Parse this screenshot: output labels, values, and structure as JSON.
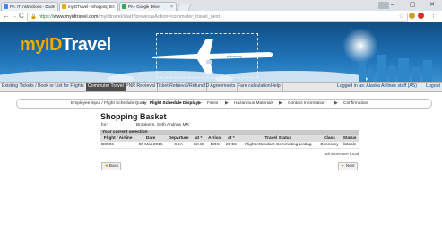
{
  "browser": {
    "tabs": [
      {
        "label": "PA: IT Instructions - Docs"
      },
      {
        "label": "myIDTravel - Shopping B..."
      },
      {
        "label": "PA - Google Drive"
      }
    ],
    "window_controls": {
      "minimize": "–",
      "maximize": "▢",
      "close": "✕"
    },
    "url": {
      "scheme": "https://",
      "host": "www.myidtravel.com",
      "path": "/myidtravel/start?previousAction=commuter_travel_next"
    }
  },
  "banner": {
    "logo_part1": "myID",
    "logo_part2": "Travel",
    "plane_text": "planeway"
  },
  "mainnav": {
    "items": [
      "Existing Tickets / Book or List for Flights",
      "Commuter Travel",
      "PNR Retrieval",
      "Ticket Retrieval/Refund",
      "ID Agreements",
      "Fare calculation",
      "Help"
    ],
    "logged_in": "Logged in as: Alaska Airlines staff (AS)",
    "logout": "Logout"
  },
  "steps": [
    "Employee input / Flight Schedule Query",
    "Flight Schedule Display",
    "Fares",
    "Hazardous Materials",
    "Contact Information",
    "Confirmation"
  ],
  "basket": {
    "title": "Shopping Basket",
    "for_label": "for:",
    "for_value": "Brookens, Seth Andrew MR",
    "selection_header": "Your current selection",
    "columns": [
      "Flight / Airline",
      "Date",
      "Departure",
      "at *",
      "Arrival",
      "at *",
      "Travel Status",
      "Class",
      "Status"
    ],
    "rows": [
      [
        "B0596",
        "06 Mar 2016",
        "SEA",
        "12:45",
        "BOS",
        "20:55",
        "Flight Attendant Commuting Listing",
        "Economy",
        "listable"
      ]
    ],
    "note": "*all times are local",
    "back": "Back",
    "next": "Next"
  }
}
